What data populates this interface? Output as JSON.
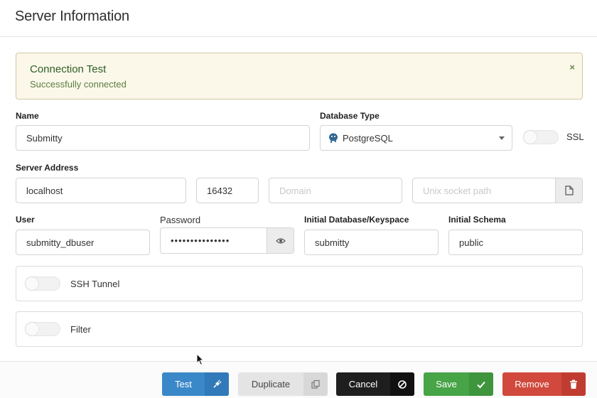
{
  "header": {
    "title": "Server Information"
  },
  "alert": {
    "title": "Connection Test",
    "message": "Successfully connected",
    "close_glyph": "×"
  },
  "form": {
    "name": {
      "label": "Name",
      "value": "Submitty"
    },
    "database_type": {
      "label": "Database Type",
      "value": "PostgreSQL",
      "icon": "postgresql-elephant-icon"
    },
    "ssl": {
      "label": "SSL",
      "enabled": false
    },
    "server_address": {
      "label": "Server Address",
      "host_value": "localhost",
      "port_value": "16432",
      "domain_placeholder": "Domain",
      "socket_placeholder": "Unix socket path",
      "socket_icon": "file-icon"
    },
    "user": {
      "label": "User",
      "value": "submitty_dbuser"
    },
    "password": {
      "label": "Password",
      "value": "•••••••••••••••",
      "toggle_icon": "eye-icon"
    },
    "initial_database": {
      "label": "Initial Database/Keyspace",
      "value": "submitty"
    },
    "initial_schema": {
      "label": "Initial Schema",
      "value": "public"
    }
  },
  "panels": {
    "ssh_tunnel": {
      "label": "SSH Tunnel",
      "enabled": false
    },
    "filter": {
      "label": "Filter",
      "enabled": false
    }
  },
  "footer": {
    "test_label": "Test",
    "duplicate_label": "Duplicate",
    "cancel_label": "Cancel",
    "save_label": "Save",
    "remove_label": "Remove"
  },
  "colors": {
    "primary": "#3b88c9",
    "success": "#47a447",
    "danger": "#d0493c",
    "dark": "#1e1e1e",
    "alert_bg": "#fbf8ea"
  }
}
